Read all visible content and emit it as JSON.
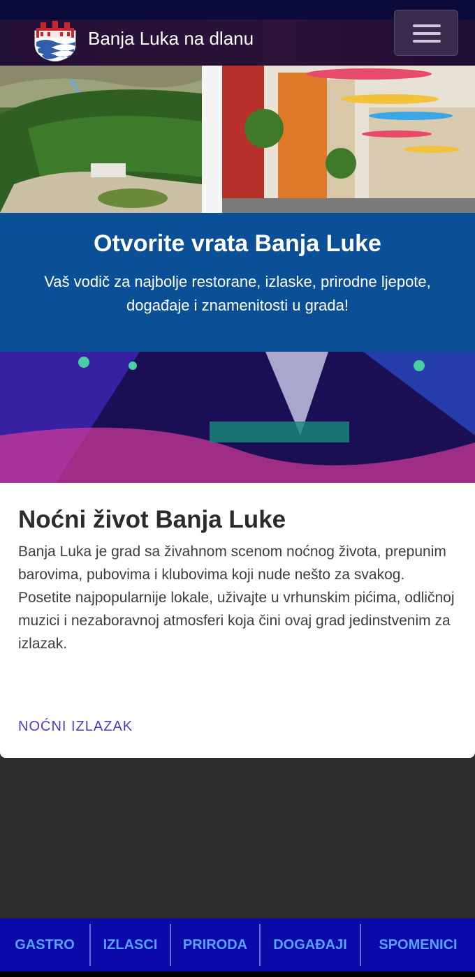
{
  "navbar": {
    "brand": "Banja Luka na dlanu",
    "logo_icon": "city-coat-of-arms-logo",
    "menu_icon": "hamburger-menu-icon"
  },
  "hero": {
    "title": "Otvorite vrata Banja Luke",
    "subtitle": "Vaš vodič za najbolje restorane, izlaske, prirodne ljepote, događaje i znamenitosti u grada!"
  },
  "card": {
    "title": "Noćni život Banja Luke",
    "paragraph1": "Banja Luka je grad sa živahnom scenom noćnog života, prepunim barovima, pubovima i klubovima koji nude nešto za svakog.",
    "paragraph2": "Posetite najpopularnije lokale, uživajte u vrhunskim pićima, odličnoj muzici i nezaboravnoj atmosferi koja čini ovaj grad jedinstvenim za izlazak.",
    "link": "NOĆNI IZLAZAK"
  },
  "bottom_nav": {
    "items": [
      "GASTRO",
      "IZLASCI",
      "PRIRODA",
      "DOGAĐAJI",
      "SPOMENICI"
    ]
  },
  "colors": {
    "navbar": "#231036",
    "hero_band": "#0b4f97",
    "bottom_nav": "#0a0aa8",
    "bottom_nav_text": "#5aa0ff",
    "link": "#4a3bd0"
  }
}
